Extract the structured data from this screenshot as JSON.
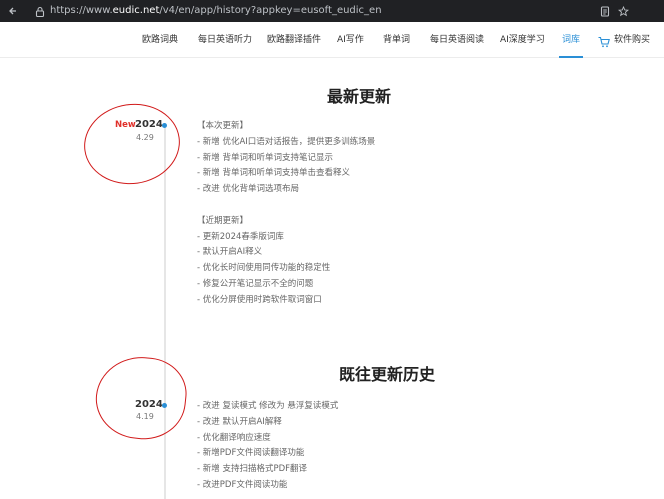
{
  "browser": {
    "url_prefix": "https://www.",
    "url_domain": "eudic.net",
    "url_rest": "/v4/en/app/history?appkey=eusoft_eudic_en"
  },
  "nav": {
    "items": [
      {
        "label": "欧路词典"
      },
      {
        "label": "每日英语听力"
      },
      {
        "label": "欧路翻译插件"
      },
      {
        "label": "AI写作"
      },
      {
        "label": "背单词"
      },
      {
        "label": "每日英语阅读"
      },
      {
        "label": "AI深度学习"
      },
      {
        "label": "词库"
      },
      {
        "label": "软件购买"
      }
    ],
    "active_index": 7,
    "accent": "#2a8fd6"
  },
  "latest": {
    "title": "最新更新",
    "badge": "New",
    "year": "2024",
    "date": "4.29",
    "lines": [
      "【本次更新】",
      "- 新增 优化AI口语对话报告，提供更多训练场景",
      "- 新增 背单词和听单词支持笔记显示",
      "- 新增 背单词和听单词支持单击查看释义",
      "- 改进 优化背单词选项布局",
      "",
      "【近期更新】",
      "- 更新2024春季版词库",
      "- 默认开启AI释义",
      "- 优化长时间使用同传功能的稳定性",
      "- 修复公开笔记显示不全的问题",
      "- 优化分屏使用时跨软件取词窗口"
    ]
  },
  "history": {
    "title": "既往更新历史",
    "year": "2024",
    "date": "4.19",
    "lines": [
      "- 改进 复读模式 修改为 悬浮复读模式",
      "- 改进 默认开启AI解释",
      "- 优化翻译响应速度",
      "- 新增PDF文件阅读翻译功能",
      "- 新增 支持扫描格式PDF翻译",
      "- 改进PDF文件阅读功能"
    ]
  },
  "annotation_color": "#d11a1a"
}
